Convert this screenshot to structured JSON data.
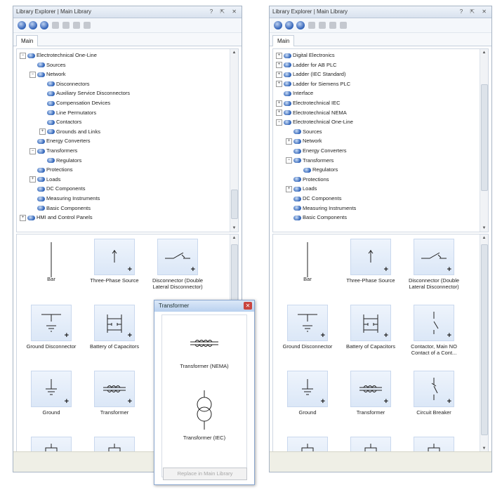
{
  "left_panel": {
    "title": "Library Explorer | Main Library",
    "window_buttons": "? ⇱ ✕",
    "tab": "Main",
    "tree": [
      {
        "expander": "−",
        "label": "Electrotechnical One-Line",
        "level": 0
      },
      {
        "expander": "",
        "label": "Sources",
        "level": 1
      },
      {
        "expander": "−",
        "label": "Network",
        "level": 1
      },
      {
        "expander": "",
        "label": "Disconnectors",
        "level": 2
      },
      {
        "expander": "",
        "label": "Auxiliary Service Disconnectors",
        "level": 2
      },
      {
        "expander": "",
        "label": "Compensation Devices",
        "level": 2
      },
      {
        "expander": "",
        "label": "Line Permutators",
        "level": 2
      },
      {
        "expander": "",
        "label": "Contactors",
        "level": 2
      },
      {
        "expander": "+",
        "label": "Grounds and Links",
        "level": 2
      },
      {
        "expander": "",
        "label": "Energy Converters",
        "level": 1
      },
      {
        "expander": "−",
        "label": "Transformers",
        "level": 1
      },
      {
        "expander": "",
        "label": "Regulators",
        "level": 2
      },
      {
        "expander": "",
        "label": "Protections",
        "level": 1
      },
      {
        "expander": "+",
        "label": "Loads",
        "level": 1
      },
      {
        "expander": "",
        "label": "DC Components",
        "level": 1
      },
      {
        "expander": "",
        "label": "Measuring Instruments",
        "level": 1
      },
      {
        "expander": "",
        "label": "Basic Components",
        "level": 1
      },
      {
        "expander": "+",
        "label": "HMI and Control Panels",
        "level": 0
      }
    ],
    "tiles": [
      {
        "label": "Bar",
        "icon": "bar-icon",
        "boxed": false
      },
      {
        "label": "Three-Phase Source",
        "icon": "three-phase-source-icon",
        "boxed": true
      },
      {
        "label": "Disconnector (Double Lateral Disconnector)",
        "icon": "disconnector-icon",
        "boxed": true
      },
      {
        "label": "Ground Disconnector",
        "icon": "ground-disconnector-icon",
        "boxed": true
      },
      {
        "label": "Battery of Capacitors",
        "icon": "capacitor-battery-icon",
        "boxed": true
      },
      {
        "label": "C",
        "icon": "",
        "boxed": false
      },
      {
        "label": "Ground",
        "icon": "ground-icon",
        "boxed": true
      },
      {
        "label": "Transformer",
        "icon": "transformer-icon",
        "boxed": true
      },
      {
        "label": "",
        "icon": "",
        "boxed": false
      },
      {
        "label": "",
        "icon": "component-icon",
        "boxed": true
      },
      {
        "label": "",
        "icon": "component-icon",
        "boxed": true
      }
    ]
  },
  "right_panel": {
    "title": "Library Explorer | Main Library",
    "window_buttons": "? ⇱ ✕",
    "tab": "Main",
    "tree": [
      {
        "expander": "+",
        "label": "Digital Electronics",
        "level": 0
      },
      {
        "expander": "+",
        "label": "Ladder for AB PLC",
        "level": 0
      },
      {
        "expander": "+",
        "label": "Ladder (IEC Standard)",
        "level": 0
      },
      {
        "expander": "+",
        "label": "Ladder for Siemens PLC",
        "level": 0
      },
      {
        "expander": "",
        "label": "Interface",
        "level": 0
      },
      {
        "expander": "+",
        "label": "Electrotechnical IEC",
        "level": 0
      },
      {
        "expander": "+",
        "label": "Electrotechnical NEMA",
        "level": 0
      },
      {
        "expander": "−",
        "label": "Electrotechnical One-Line",
        "level": 0
      },
      {
        "expander": "",
        "label": "Sources",
        "level": 1
      },
      {
        "expander": "+",
        "label": "Network",
        "level": 1
      },
      {
        "expander": "",
        "label": "Energy Converters",
        "level": 1
      },
      {
        "expander": "−",
        "label": "Transformers",
        "level": 1
      },
      {
        "expander": "",
        "label": "Regulators",
        "level": 2
      },
      {
        "expander": "",
        "label": "Protections",
        "level": 1
      },
      {
        "expander": "+",
        "label": "Loads",
        "level": 1
      },
      {
        "expander": "",
        "label": "DC Components",
        "level": 1
      },
      {
        "expander": "",
        "label": "Measuring Instruments",
        "level": 1
      },
      {
        "expander": "",
        "label": "Basic Components",
        "level": 1
      }
    ],
    "tiles": [
      {
        "label": "Bar",
        "icon": "bar-icon",
        "boxed": false
      },
      {
        "label": "Three-Phase Source",
        "icon": "three-phase-source-icon",
        "boxed": true
      },
      {
        "label": "Disconnector (Double Lateral Disconnector)",
        "icon": "disconnector-icon",
        "boxed": true
      },
      {
        "label": "Ground Disconnector",
        "icon": "ground-disconnector-icon",
        "boxed": true
      },
      {
        "label": "Battery of Capacitors",
        "icon": "capacitor-battery-icon",
        "boxed": true
      },
      {
        "label": "Contactor, Main NO Contact of a Cont...",
        "icon": "contactor-icon",
        "boxed": true
      },
      {
        "label": "Ground",
        "icon": "ground-icon",
        "boxed": true
      },
      {
        "label": "Transformer",
        "icon": "transformer-icon",
        "boxed": true
      },
      {
        "label": "Circuit Breaker",
        "icon": "circuit-breaker-icon",
        "boxed": true
      },
      {
        "label": "",
        "icon": "component-icon",
        "boxed": true
      },
      {
        "label": "",
        "icon": "component-icon",
        "boxed": true
      },
      {
        "label": "",
        "icon": "component-icon",
        "boxed": true
      }
    ]
  },
  "popup": {
    "title": "Transformer",
    "close": "✕",
    "items": [
      {
        "label": "Transformer (NEMA)",
        "icon": "transformer-nema-icon"
      },
      {
        "label": "Transformer (IEC)",
        "icon": "transformer-iec-icon"
      }
    ],
    "button": "Replace in Main Library"
  },
  "colors": {
    "accent": "#2f63b8",
    "tile_bg": "#dbe7f7",
    "close": "#c9453f"
  }
}
